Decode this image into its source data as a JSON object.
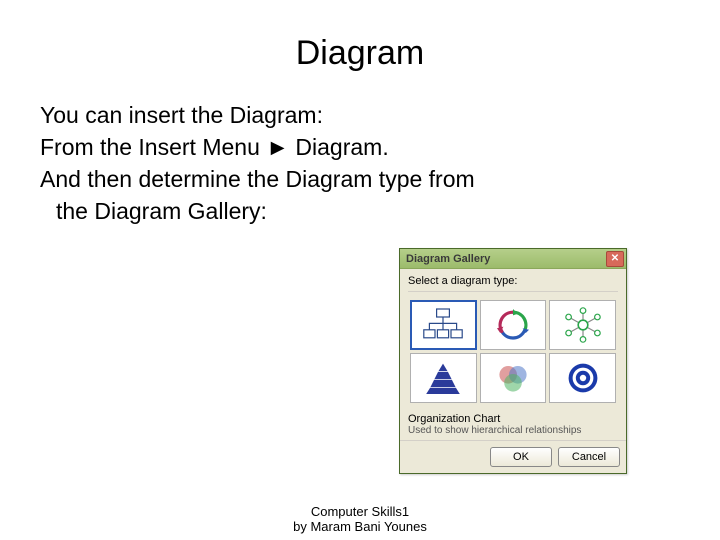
{
  "slide": {
    "title": "Diagram",
    "body": {
      "l1": "You can insert the Diagram:",
      "l2": "From the Insert Menu ► Diagram.",
      "l3": "And then determine the Diagram type from",
      "l4": "the Diagram Gallery:"
    },
    "footer": {
      "l1": "Computer Skills1",
      "l2": "by Maram Bani Younes"
    }
  },
  "dialog": {
    "title": "Diagram Gallery",
    "prompt": "Select a diagram type:",
    "tiles": {
      "org": "Organization Chart",
      "cycle": "Cycle Diagram",
      "radial": "Radial Diagram",
      "pyramid": "Pyramid Diagram",
      "venn": "Venn Diagram",
      "target": "Target Diagram"
    },
    "selected_name": "Organization Chart",
    "selected_desc": "Used to show hierarchical relationships",
    "ok": "OK",
    "cancel": "Cancel"
  }
}
